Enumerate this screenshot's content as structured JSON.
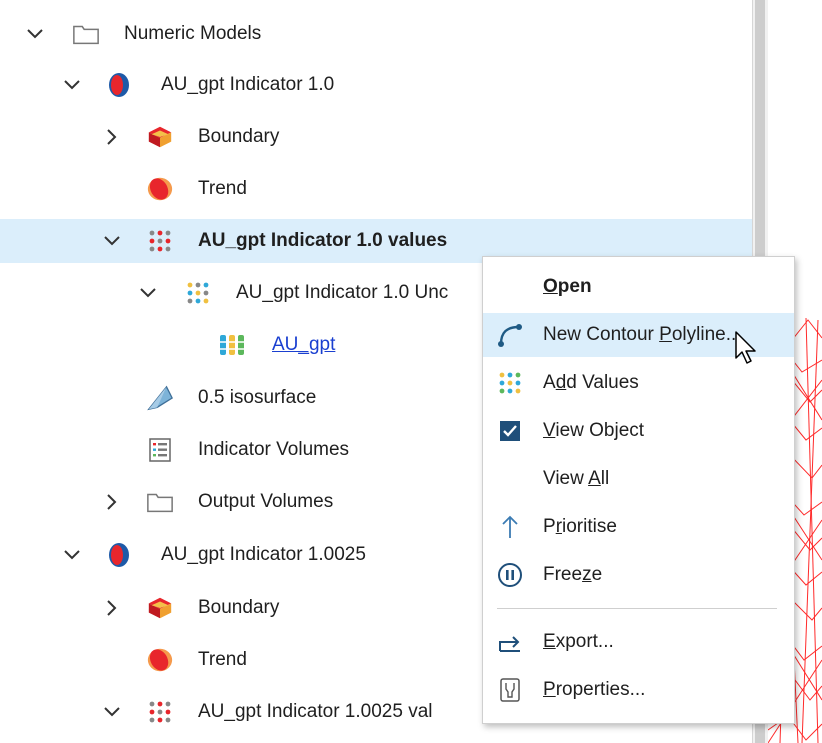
{
  "tree": {
    "rows": [
      {
        "label": "Numeric Models",
        "expander": "expanded",
        "icon": "folder-icon",
        "bold": false
      },
      {
        "label": "AU_gpt Indicator 1.0",
        "expander": "expanded",
        "icon": "numeric-model-icon",
        "bold": false
      },
      {
        "label": "Boundary",
        "expander": "collapsed",
        "icon": "boundary-icon",
        "bold": false
      },
      {
        "label": "Trend",
        "expander": "none",
        "icon": "trend-icon",
        "bold": false
      },
      {
        "label": "AU_gpt Indicator 1.0 values",
        "expander": "expanded",
        "icon": "values-icon",
        "bold": true,
        "selected": true
      },
      {
        "label": "AU_gpt Indicator 1.0 Unc",
        "expander": "expanded",
        "icon": "values-light-icon",
        "bold": false
      },
      {
        "label": "AU_gpt",
        "expander": "none",
        "icon": "column-values-icon",
        "bold": false,
        "link": true
      },
      {
        "label": "0.5 isosurface",
        "expander": "none",
        "icon": "isosurface-icon",
        "bold": false
      },
      {
        "label": "Indicator Volumes",
        "expander": "none",
        "icon": "table-icon",
        "bold": false
      },
      {
        "label": "Output Volumes",
        "expander": "collapsed",
        "icon": "folder-icon",
        "bold": false
      },
      {
        "label": "AU_gpt Indicator 1.0025",
        "expander": "expanded",
        "icon": "numeric-model-icon",
        "bold": false
      },
      {
        "label": "Boundary",
        "expander": "collapsed",
        "icon": "boundary-icon",
        "bold": false
      },
      {
        "label": "Trend",
        "expander": "none",
        "icon": "trend-icon",
        "bold": false
      },
      {
        "label": "AU_gpt Indicator 1.0025 val",
        "expander": "expanded",
        "icon": "values-icon",
        "bold": false
      }
    ]
  },
  "context_menu": {
    "items": [
      {
        "pre": "",
        "key": "O",
        "post": "pen",
        "icon": "",
        "bold": true
      },
      {
        "pre": "New Contour ",
        "key": "P",
        "post": "olyline...",
        "icon": "contour-polyline-icon",
        "hover": true
      },
      {
        "pre": "A",
        "key": "d",
        "post": "d Values",
        "icon": "add-values-icon"
      },
      {
        "pre": "",
        "key": "V",
        "post": "iew Object",
        "icon": "checkbox-checked-icon"
      },
      {
        "pre": "View ",
        "key": "A",
        "post": "ll",
        "icon": ""
      },
      {
        "pre": "P",
        "key": "r",
        "post": "ioritise",
        "icon": "arrow-up-icon"
      },
      {
        "pre": "Free",
        "key": "z",
        "post": "e",
        "icon": "pause-circle-icon"
      },
      {
        "pre": "",
        "key": "E",
        "post": "xport...",
        "icon": "export-icon"
      },
      {
        "pre": "",
        "key": "P",
        "post": "roperties...",
        "icon": "properties-icon"
      }
    ]
  },
  "colors": {
    "selection": "#dbeefb",
    "link": "#1a3fd0",
    "mesh": "#ff2a2a",
    "accent": "#1f5a84"
  }
}
